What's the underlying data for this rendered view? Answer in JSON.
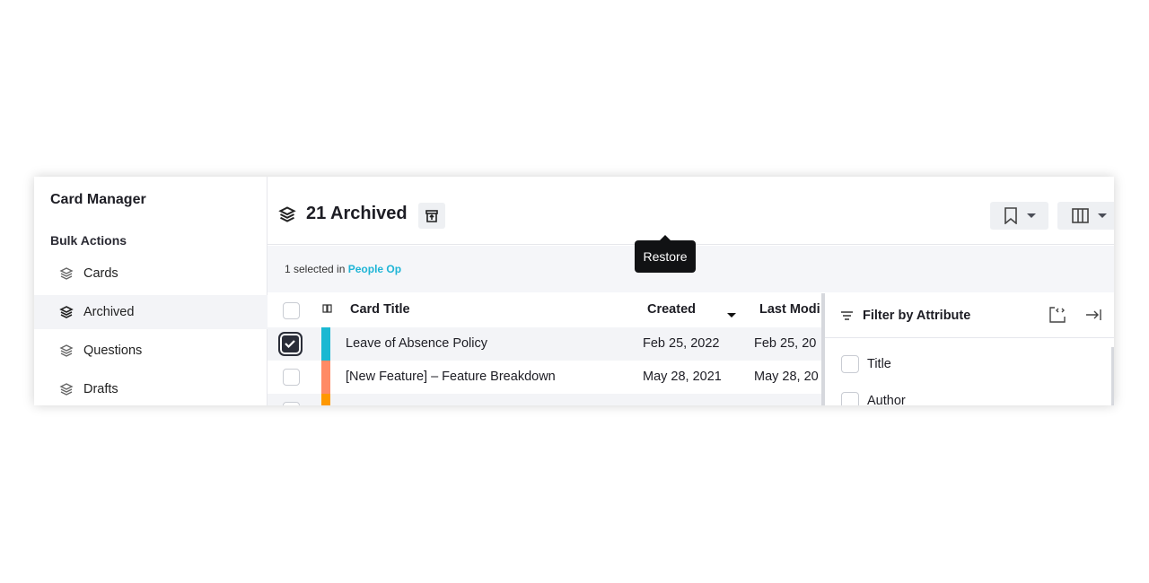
{
  "sidebar": {
    "title": "Card Manager",
    "section": "Bulk Actions",
    "items": [
      {
        "label": "Cards",
        "icon": "layers-icon"
      },
      {
        "label": "Archived",
        "icon": "layers-icon",
        "active": true
      },
      {
        "label": "Questions",
        "icon": "layers-icon"
      },
      {
        "label": "Drafts",
        "icon": "layers-icon"
      }
    ]
  },
  "header": {
    "title": "21 Archived",
    "restore_tooltip": "Restore"
  },
  "selection": {
    "prefix": "1 selected in",
    "collection": "People Op"
  },
  "table": {
    "columns": [
      "Card Title",
      "Created",
      "Last Modi"
    ],
    "rows": [
      {
        "title": "Leave of Absence Policy",
        "created": "Feb 25, 2022",
        "modified": "Feb 25, 20",
        "checked": true,
        "color": "#1ab8d2"
      },
      {
        "title": "[New Feature] – Feature Breakdown",
        "created": "May 28, 2021",
        "modified": "May 28, 20",
        "checked": false,
        "color": "#ff8a65"
      },
      {
        "title": "",
        "created": "",
        "modified": "",
        "checked": false,
        "color": "#ff9800"
      }
    ]
  },
  "filter_panel": {
    "title": "Filter by Attribute",
    "items": [
      "Title",
      "Author"
    ]
  }
}
